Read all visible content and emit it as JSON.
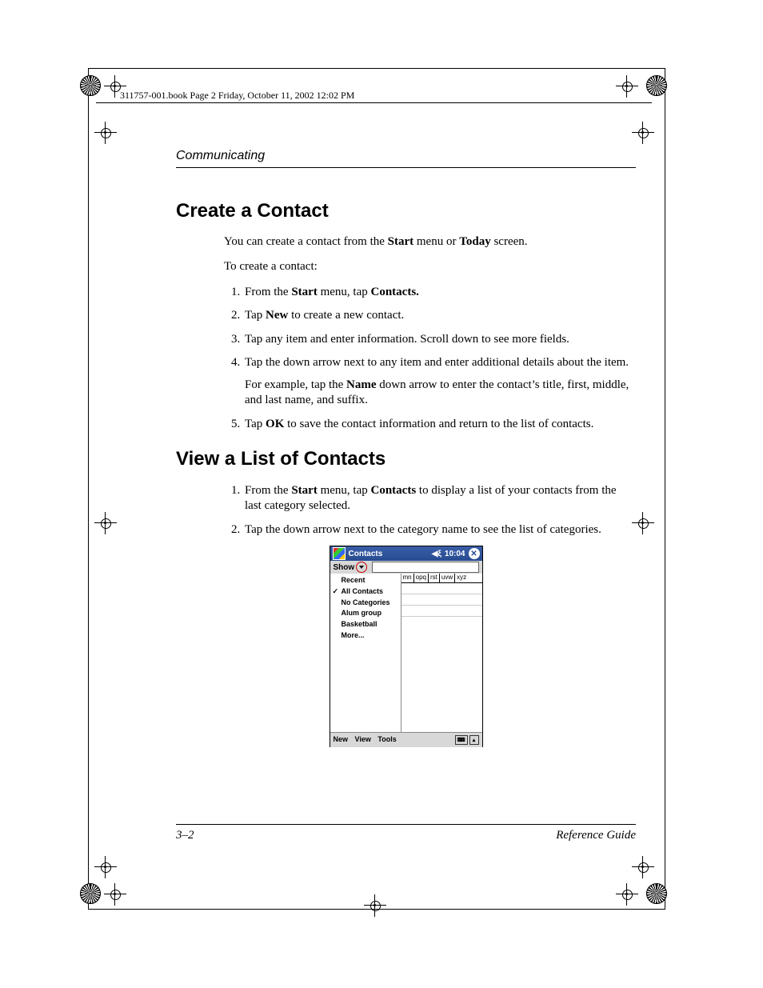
{
  "header": {
    "book_stamp": "311757-001.book  Page 2  Friday, October 11, 2002  12:02 PM"
  },
  "running_head": "Communicating",
  "section1": {
    "title": "Create a Contact",
    "intro_pre": "You can create a contact from the ",
    "intro_b1": "Start",
    "intro_mid": " menu or ",
    "intro_b2": "Today",
    "intro_post": " screen.",
    "lead": "To create a contact:",
    "step1_a": "From the ",
    "step1_b": "Start",
    "step1_c": " menu, tap ",
    "step1_d": "Contacts.",
    "step2_a": "Tap ",
    "step2_b": "New",
    "step2_c": " to create a new contact.",
    "step3": "Tap any item and enter information. Scroll down to see more fields.",
    "step4": "Tap the down arrow next to any item and enter additional details about the item.",
    "step4_ex_a": "For example, tap the ",
    "step4_ex_b": "Name",
    "step4_ex_c": " down arrow to enter the contact’s title, first, middle, and last name, and suffix.",
    "step5_a": "Tap ",
    "step5_b": "OK",
    "step5_c": " to save the contact information and return to the list of contacts."
  },
  "section2": {
    "title": "View a List of Contacts",
    "step1_a": "From the ",
    "step1_b": "Start",
    "step1_c": " menu, tap ",
    "step1_d": "Contacts",
    "step1_e": " to display a list of your contacts from the last category selected.",
    "step2": "Tap the down arrow next to the category name to see the list of categories."
  },
  "pda": {
    "title": "Contacts",
    "time": "10:04",
    "show_label": "Show",
    "dropdown": {
      "recent": "Recent",
      "all": "All Contacts",
      "nocat": "No Categories",
      "alum": "Alum group",
      "basketball": "Basketball",
      "more": "More..."
    },
    "alpha": [
      "mn",
      "opq",
      "rst",
      "uvw",
      "xyz"
    ],
    "menu": {
      "new": "New",
      "view": "View",
      "tools": "Tools"
    }
  },
  "footer": {
    "page": "3–2",
    "guide": "Reference Guide"
  }
}
